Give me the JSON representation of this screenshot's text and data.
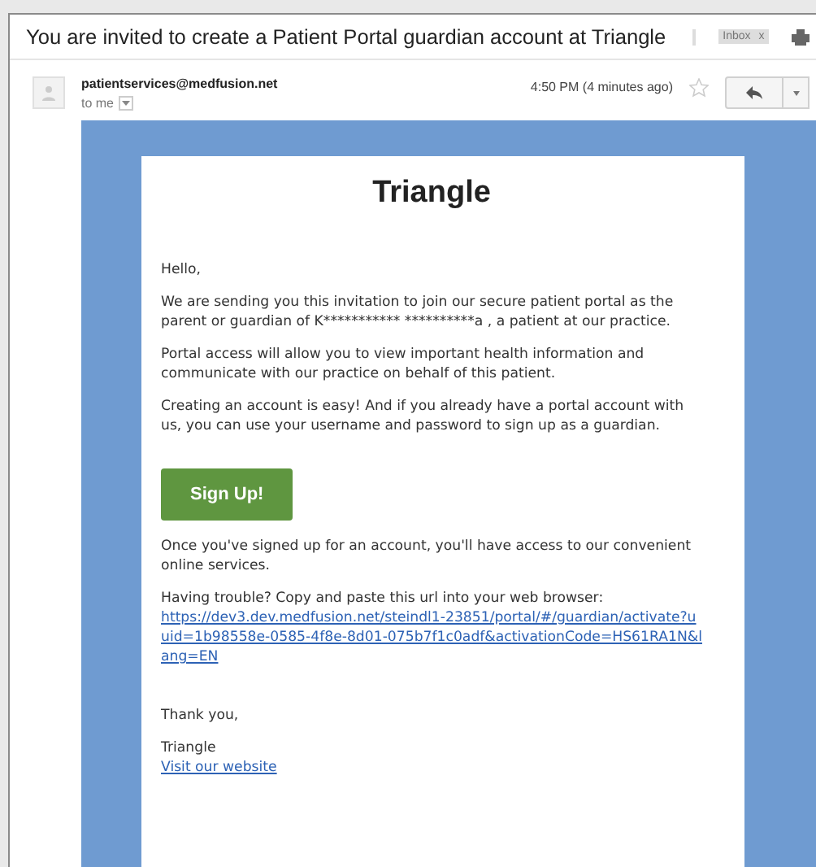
{
  "email": {
    "subject": "You are invited to create a Patient Portal guardian account at Triangle",
    "label": "Inbox",
    "label_close": "x",
    "sender": "patientservices@medfusion.net",
    "recipient": "to me",
    "time": "4:50 PM (4 minutes ago)",
    "starred": false
  },
  "message": {
    "brand": "Triangle",
    "greeting": "Hello,",
    "paragraphs": [
      "We are sending you this invitation to join our secure patient portal as the parent or guardian of K*********** **********a , a patient at our practice.",
      "Portal access will allow you to view important health information and communicate with our practice on behalf of this patient.",
      "Creating an account is easy! And if you already have a portal account with us, you can use your username and password to sign up as a guardian."
    ],
    "button": "Sign Up!",
    "after_button": "Once you've signed up for an account, you'll have access to our convenient online services.",
    "trouble": "Having trouble? Copy and paste this url into your web browser:",
    "url": "https://dev3.dev.medfusion.net/steindl1-23851/portal/#/guardian/activate?uuid=1b98558e-0585-4f8e-8d01-075b7f1c0adf&activationCode=HS61RA1N&lang=EN",
    "thanks": "Thank you,",
    "signature": "Triangle",
    "website_link": "Visit our website"
  }
}
